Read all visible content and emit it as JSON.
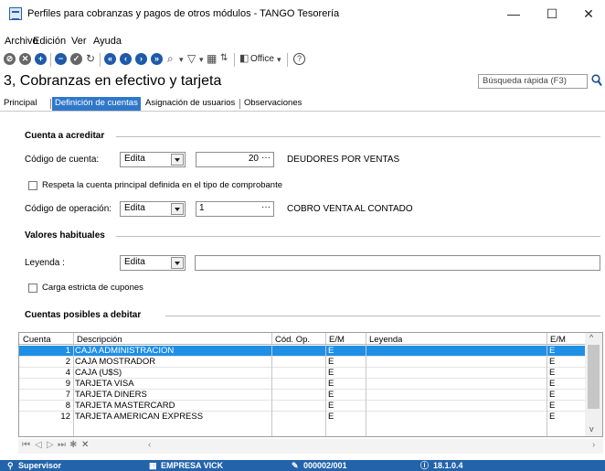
{
  "window": {
    "title": "Perfiles para cobranzas y pagos de otros módulos - TANGO Tesorería",
    "minimize": "—",
    "maximize": "☐",
    "close": "✕"
  },
  "menu": [
    "Archivo",
    "Edición",
    "Ver",
    "Ayuda"
  ],
  "toolbar": {
    "office_label": "Office",
    "help": "?"
  },
  "header": {
    "title": "3, Cobranzas en efectivo y tarjeta",
    "search_placeholder": "Búsqueda rápida (F3)"
  },
  "tabs": [
    "Principal",
    "Definición de cuentas",
    "Asignación de usuarios",
    "Observaciones"
  ],
  "form": {
    "cuenta_section": "Cuenta a acreditar",
    "codigo_cuenta_label": "Código de cuenta:",
    "codigo_cuenta_mode": "Edita",
    "codigo_cuenta_value": "20",
    "codigo_cuenta_desc": "DEUDORES POR VENTAS",
    "respeta_label": "Respeta la cuenta principal definida en el tipo de comprobante",
    "codigo_operacion_label": "Código de operación:",
    "codigo_operacion_mode": "Edita",
    "codigo_operacion_value": "1",
    "codigo_operacion_desc": "COBRO VENTA AL CONTADO",
    "valores_section": "Valores habituales",
    "leyenda_label": "Leyenda :",
    "leyenda_mode": "Edita",
    "leyenda_value": "",
    "carga_label": "Carga estricta de cupones",
    "cuentas_section": "Cuentas posibles a debitar",
    "ellipsis": "···"
  },
  "grid": {
    "columns": [
      "Cuenta",
      "Descripción",
      "Cód. Op.",
      "E/M",
      "Leyenda",
      "E/M"
    ],
    "rows": [
      {
        "cuenta": "1",
        "desc": "CAJA ADMINISTRACION",
        "codop": "",
        "em": "E",
        "leyenda": "",
        "em2": "E"
      },
      {
        "cuenta": "2",
        "desc": "CAJA MOSTRADOR",
        "codop": "",
        "em": "E",
        "leyenda": "",
        "em2": "E"
      },
      {
        "cuenta": "4",
        "desc": "CAJA (U$S)",
        "codop": "",
        "em": "E",
        "leyenda": "",
        "em2": "E"
      },
      {
        "cuenta": "9",
        "desc": "TARJETA VISA",
        "codop": "",
        "em": "E",
        "leyenda": "",
        "em2": "E"
      },
      {
        "cuenta": "7",
        "desc": "TARJETA DINERS",
        "codop": "",
        "em": "E",
        "leyenda": "",
        "em2": "E"
      },
      {
        "cuenta": "8",
        "desc": "TARJETA MASTERCARD",
        "codop": "",
        "em": "E",
        "leyenda": "",
        "em2": "E"
      },
      {
        "cuenta": "12",
        "desc": "TARJETA AMERICAN EXPRESS",
        "codop": "",
        "em": "E",
        "leyenda": "",
        "em2": "E"
      }
    ]
  },
  "status": {
    "user": "Supervisor",
    "company": "EMPRESA VICK",
    "code": "000002/001",
    "version": "18.1.0.4"
  },
  "colors": {
    "accent": "#2f78c9",
    "selected_row": "#1f8fe6",
    "statusbar": "#2363aa"
  }
}
